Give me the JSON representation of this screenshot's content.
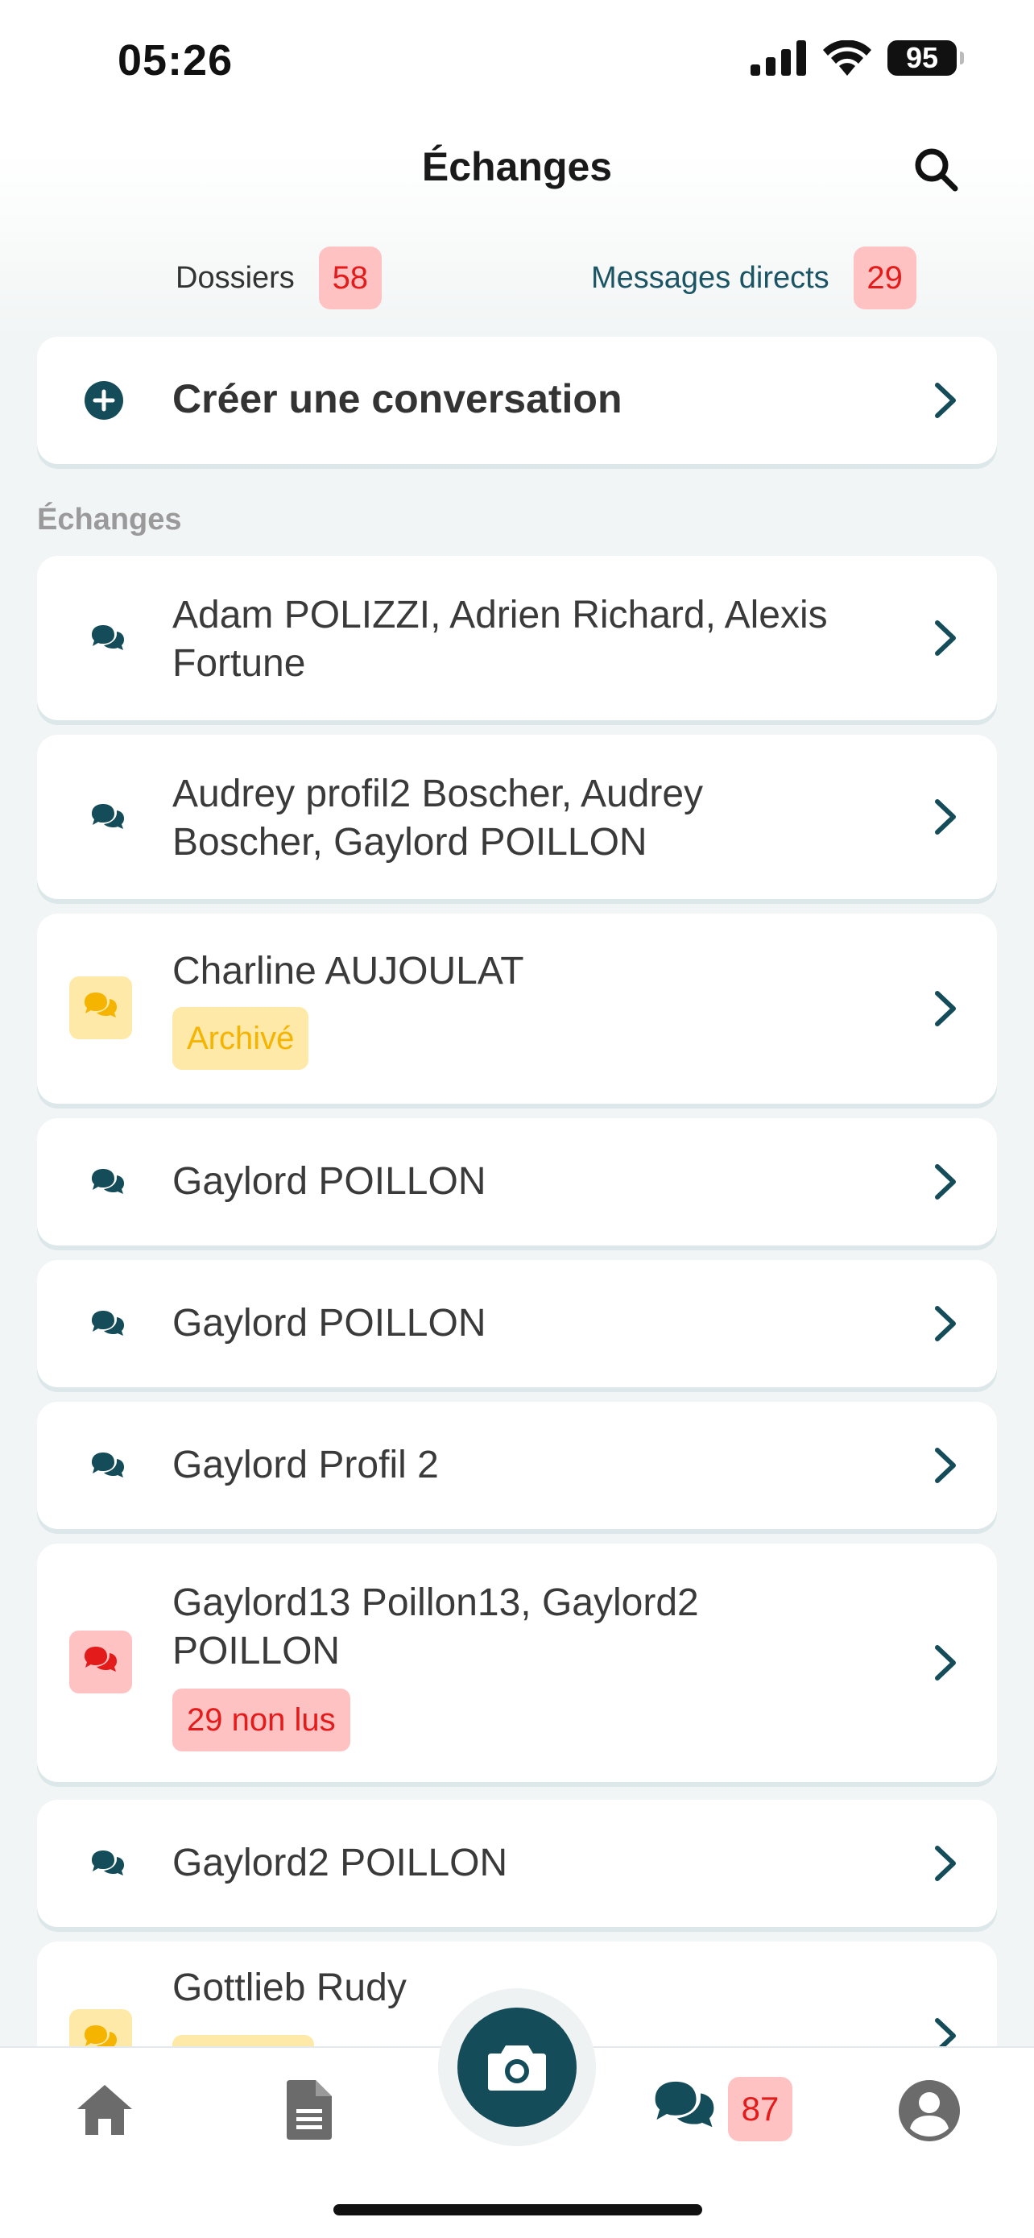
{
  "status_bar": {
    "time": "05:26",
    "battery": "95"
  },
  "header": {
    "title": "Échanges"
  },
  "tabs": [
    {
      "label": "Dossiers",
      "badge": "58"
    },
    {
      "label": "Messages directs",
      "badge": "29"
    }
  ],
  "create": {
    "label": "Créer une conversation"
  },
  "section": {
    "label": "Échanges"
  },
  "conversations": [
    {
      "title_line1": "Adam POLIZZI, Adrien Richard, Alexis",
      "title_line2": "Fortune",
      "icon_style": "plain"
    },
    {
      "title_line1": "Audrey profil2 Boscher, Audrey",
      "title_line2": "Boscher, Gaylord POILLON",
      "icon_style": "plain"
    },
    {
      "title_line1": "Charline AUJOULAT",
      "tag": "Archivé",
      "icon_style": "yellow"
    },
    {
      "title_line1": "Gaylord POILLON",
      "icon_style": "plain"
    },
    {
      "title_line1": "Gaylord POILLON",
      "icon_style": "plain"
    },
    {
      "title_line1": "Gaylord Profil 2",
      "icon_style": "plain"
    },
    {
      "title_line1": "Gaylord13 Poillon13, Gaylord2",
      "title_line2": "POILLON",
      "tag": "29 non lus",
      "icon_style": "red"
    },
    {
      "title_line1": "Gaylord2 POILLON",
      "icon_style": "plain"
    },
    {
      "title_line1": "Gottlieb Rudy",
      "icon_style": "yellow"
    }
  ],
  "tabbar": {
    "chat_badge": "87"
  },
  "colors": {
    "primary": "#154c5a",
    "badge_bg": "#ffc2c2",
    "badge_text": "#e41b1b",
    "archived_bg": "#ffe9a8",
    "archived_text": "#f4b400",
    "background": "#f2f5f5"
  },
  "icons": [
    "search-icon",
    "plus-circle-icon",
    "chevron-right-icon",
    "chat-bubbles-icon",
    "home-icon",
    "document-icon",
    "camera-icon",
    "profile-icon"
  ]
}
